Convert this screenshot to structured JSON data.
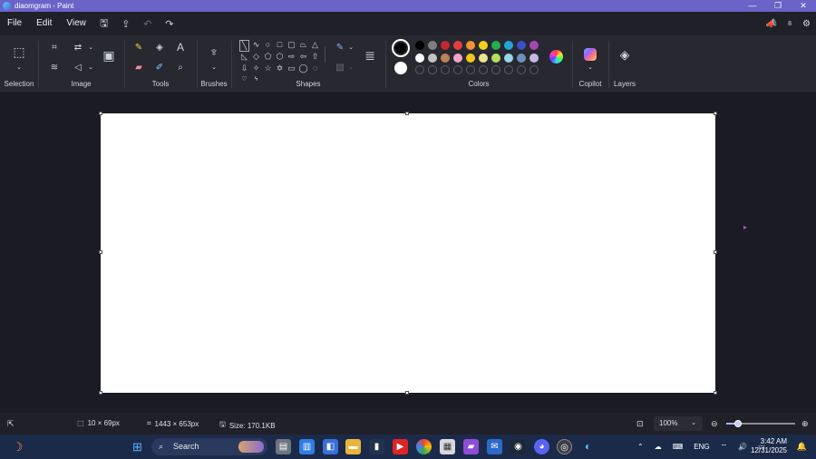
{
  "window": {
    "title": "diaomgram - Paint",
    "controls": [
      "—",
      "❐",
      "✕"
    ]
  },
  "menu": {
    "items": [
      "File",
      "Edit",
      "View"
    ]
  },
  "ribbon": {
    "groups": {
      "selection": "Selection",
      "image": "Image",
      "tools": "Tools",
      "brushes": "Brushes",
      "shapes": "Shapes",
      "colors": "Colors",
      "copilot": "Copilot",
      "layers": "Layers"
    }
  },
  "colors": {
    "row1": [
      "#000000",
      "#7f7f7f",
      "#c3272f",
      "#e43e3e",
      "#f39230",
      "#f2d01f",
      "#25ae4f",
      "#22a5d6",
      "#3a4fc6",
      "#a247b2"
    ],
    "row2": [
      "#ffffff",
      "#c3c3c3",
      "#b98456",
      "#f2a6c9",
      "#f5c51d",
      "#ede38f",
      "#b3e05a",
      "#96d5ec",
      "#6f8fbe",
      "#c6b8e3"
    ],
    "primary": "#000000",
    "secondary": "#ffffff"
  },
  "status": {
    "selection_size": "10 × 69px",
    "canvas_size": "1443 × 653px",
    "file_size": "Size: 170.1KB",
    "zoom": "100%"
  },
  "taskbar": {
    "search_placeholder": "Search",
    "language": "ENG",
    "time": "3:42 AM",
    "date": "12/31/2025"
  }
}
